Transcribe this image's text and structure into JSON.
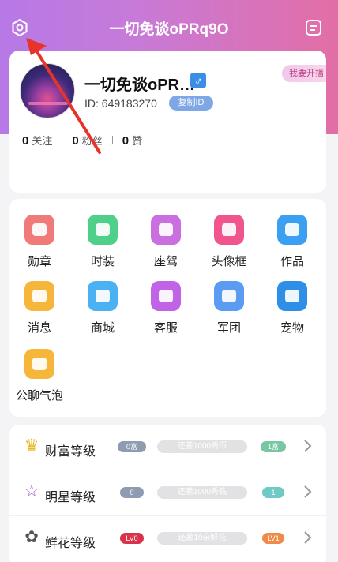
{
  "header": {
    "title": "一切免谈oPRq9O",
    "settings_icon": "gear-icon",
    "menu_icon": "menu-icon"
  },
  "profile": {
    "username": "一切免谈oPR…",
    "gender_symbol": "♂",
    "live_label": "我要开播",
    "id_text": "ID: 649183270",
    "copy_label": "复制ID",
    "stats": [
      {
        "value": "0",
        "label": "关注"
      },
      {
        "value": "0",
        "label": "粉丝"
      },
      {
        "value": "0",
        "label": "赞"
      }
    ]
  },
  "grid": [
    {
      "label": "勋章",
      "icon": "medal-icon",
      "color": "#f07a7a"
    },
    {
      "label": "时装",
      "icon": "shirt-icon",
      "color": "#4fd08a"
    },
    {
      "label": "座驾",
      "icon": "car-icon",
      "color": "#c96fe0"
    },
    {
      "label": "头像框",
      "icon": "avatar-frame-icon",
      "color": "#f0558e"
    },
    {
      "label": "作品",
      "icon": "star-icon",
      "color": "#3ba0f2"
    },
    {
      "label": "消息",
      "icon": "message-icon",
      "color": "#f6b63a"
    },
    {
      "label": "商城",
      "icon": "store-icon",
      "color": "#4ab2f2"
    },
    {
      "label": "客服",
      "icon": "headset-icon",
      "color": "#c163e6"
    },
    {
      "label": "军团",
      "icon": "shield-icon",
      "color": "#5a9cf2"
    },
    {
      "label": "宠物",
      "icon": "pet-icon",
      "color": "#2f8ee6"
    },
    {
      "label": "公聊气泡",
      "icon": "chat-bubble-icon",
      "color": "#f6b63a"
    }
  ],
  "levels": [
    {
      "name": "财富等级",
      "icon": "crown-icon",
      "current_badge": "0富",
      "progress_text": "还差1000秀币",
      "next_badge": "1富"
    },
    {
      "name": "明星等级",
      "icon": "star-outline-icon",
      "current_badge": "0",
      "progress_text": "还差1000秀钻",
      "next_badge": "1"
    },
    {
      "name": "鲜花等级",
      "icon": "flower-icon",
      "current_badge": "LV0",
      "progress_text": "还差10朵鲜花",
      "next_badge": "LV1"
    }
  ],
  "colors": {
    "header_gradient_start": "#b679e6",
    "header_gradient_end": "#e36ea6",
    "annotation_arrow": "#e8332a"
  }
}
